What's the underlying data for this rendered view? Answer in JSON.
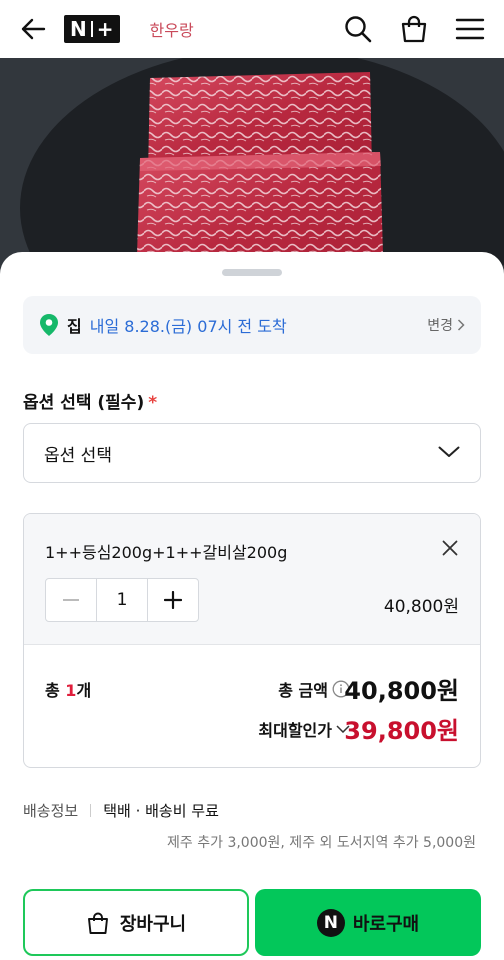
{
  "header": {
    "brand_left": "N",
    "brand_right": "+",
    "sub_brand": "한우랑"
  },
  "delivery": {
    "place": "집",
    "eta": "내일 8.28.(금) 07시 전 도착",
    "change_label": "변경"
  },
  "option": {
    "title": "옵션 선택 (필수)",
    "required_mark": "*",
    "select_placeholder": "옵션 선택"
  },
  "selected_item": {
    "name": "1++등심200g+1++갈비살200g",
    "quantity": "1",
    "price": "40,800원"
  },
  "summary": {
    "total_count_prefix": "총 ",
    "total_count_num": "1",
    "total_count_suffix": "개",
    "total_label": "총 금액",
    "total_amount": "40,800원",
    "discount_label": "최대할인가",
    "discount_amount": "39,800원"
  },
  "shipping": {
    "label": "배송정보",
    "method": "택배 · 배송비 무료",
    "extra": "제주 추가 3,000원, 제주 외 도서지역 추가 5,000원"
  },
  "actions": {
    "cart_label": "장바구니",
    "buy_badge": "N",
    "buy_label": "바로구매"
  },
  "colors": {
    "accent_green": "#03c75a",
    "discount_red": "#c8102e",
    "eta_blue": "#2b6cd6"
  }
}
